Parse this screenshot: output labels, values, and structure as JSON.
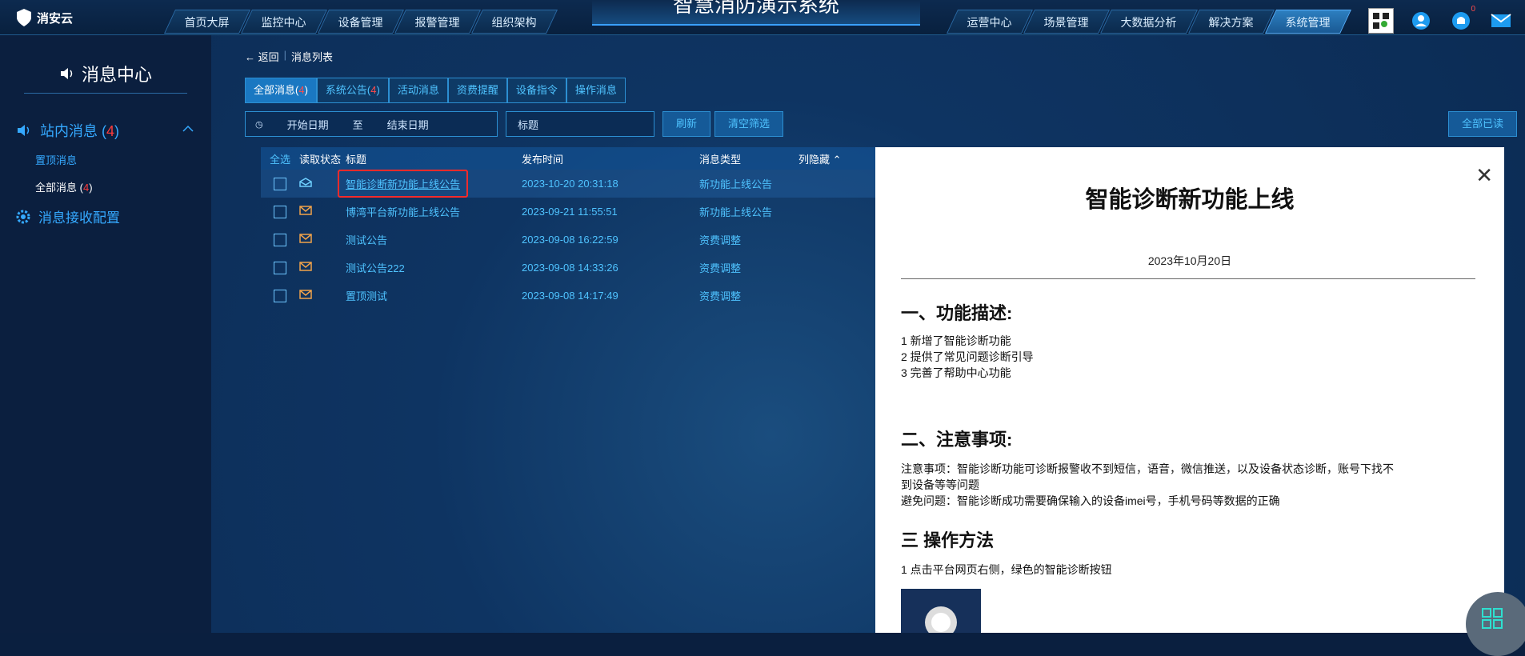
{
  "brand": {
    "name": "消安云"
  },
  "nav_left": [
    "首页大屏",
    "监控中心",
    "设备管理",
    "报警管理",
    "组织架构"
  ],
  "system_title": "智慧消防演示系统",
  "nav_right": [
    "运营中心",
    "场景管理",
    "大数据分析",
    "解决方案",
    "系统管理"
  ],
  "notification_badge": "0",
  "sidebar": {
    "title": "消息中心",
    "inbox_label": "站内消息 (",
    "inbox_count": "4",
    "inbox_close": ")",
    "sub_top": "置顶消息",
    "sub_all": "全部消息 (",
    "sub_all_count": "4",
    "sub_all_close": ")",
    "config": "消息接收配置"
  },
  "breadcrumb": {
    "back": "返回",
    "current": "消息列表"
  },
  "tabs": [
    {
      "label": "全部消息(",
      "count": "4",
      "close": ")"
    },
    {
      "label": "系统公告(",
      "count": "4",
      "close": ")"
    },
    {
      "label": "活动消息"
    },
    {
      "label": "资费提醒"
    },
    {
      "label": "设备指令"
    },
    {
      "label": "操作消息"
    }
  ],
  "filters": {
    "start": "开始日期",
    "to": "至",
    "end": "结束日期",
    "title_placeholder": "标题",
    "refresh": "刷新",
    "clear": "清空筛选",
    "read_all": "全部已读"
  },
  "table": {
    "headers": {
      "all": "全选",
      "status": "读取状态",
      "title": "标题",
      "time": "发布时间",
      "type": "消息类型",
      "hide": "列隐藏"
    },
    "rows": [
      {
        "title": "智能诊断新功能上线公告",
        "time": "2023-10-20 20:31:18",
        "type": "新功能上线公告"
      },
      {
        "title": "博湾平台新功能上线公告",
        "time": "2023-09-21 11:55:51",
        "type": "新功能上线公告"
      },
      {
        "title": "测试公告",
        "time": "2023-09-08 16:22:59",
        "type": "资费调整"
      },
      {
        "title": "测试公告222",
        "time": "2023-09-08 14:33:26",
        "type": "资费调整"
      },
      {
        "title": "置顶测试",
        "time": "2023-09-08 14:17:49",
        "type": "资费调整"
      }
    ]
  },
  "detail": {
    "title": "智能诊断新功能上线",
    "date": "2023年10月20日",
    "h1": "一、功能描述:",
    "l1": "1 新增了智能诊断功能",
    "l2": "2 提供了常见问题诊断引导",
    "l3": "3 完善了帮助中心功能",
    "h2": "二、注意事项:",
    "n1": "注意事项：智能诊断功能可诊断报警收不到短信，语音，微信推送，以及设备状态诊断，账号下找不",
    "n2": "到设备等等问题",
    "n3": "避免问题：智能诊断成功需要确保输入的设备imei号，手机号码等数据的正确",
    "h3": "三 操作方法",
    "op1": "1 点击平台网页右侧，绿色的智能诊断按钮"
  },
  "colors": {
    "accent": "#35a9ff",
    "highlight": "#ff2a2a"
  }
}
